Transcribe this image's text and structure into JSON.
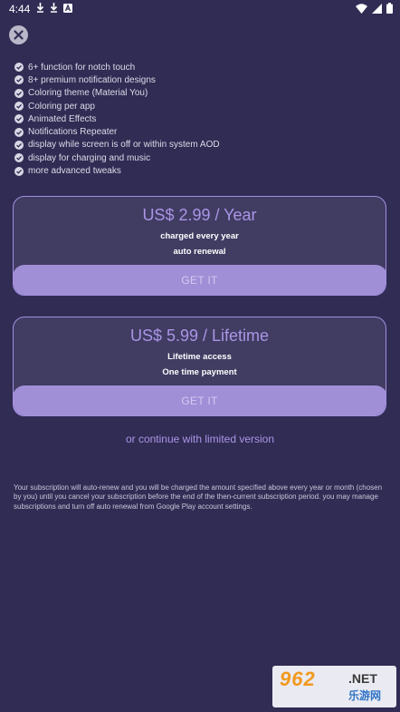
{
  "status_bar": {
    "time": "4:44",
    "notification_icons": [
      "download-icon",
      "download-icon",
      "a-notification-icon"
    ],
    "right_icons": [
      "wifi-icon",
      "signal-icon",
      "battery-icon"
    ]
  },
  "close_button": {
    "icon": "close-icon"
  },
  "features": [
    "6+ function for notch touch",
    "8+ premium notification designs",
    "Coloring theme (Material You)",
    "Coloring per app",
    "Animated Effects",
    "Notifications Repeater",
    "display while screen is off or within system AOD",
    "display for charging and music",
    "more advanced tweaks"
  ],
  "plans": {
    "year": {
      "price": "US$ 2.99 / Year",
      "line1": "charged every year",
      "line2": "auto renewal",
      "button": "GET IT"
    },
    "lifetime": {
      "price": "US$ 5.99 / Lifetime",
      "line1": "Lifetime access",
      "line2": "One time payment",
      "button": "GET IT"
    }
  },
  "continue_link": "or continue with limited version",
  "disclaimer": "Your subscription will auto-renew and you will be charged the amount specified above every year or month (chosen by you) until you cancel your subscription before the end of the then-current subscription period. you may manage subscriptions and turn off auto renewal from Google Play account settings.",
  "watermark": {
    "logo": "962",
    "net": ".NET",
    "sub": "乐游网"
  },
  "colors": {
    "background": "#302c54",
    "card_background": "#403c62",
    "accent": "#ab95e6",
    "button": "#a08fd6"
  }
}
